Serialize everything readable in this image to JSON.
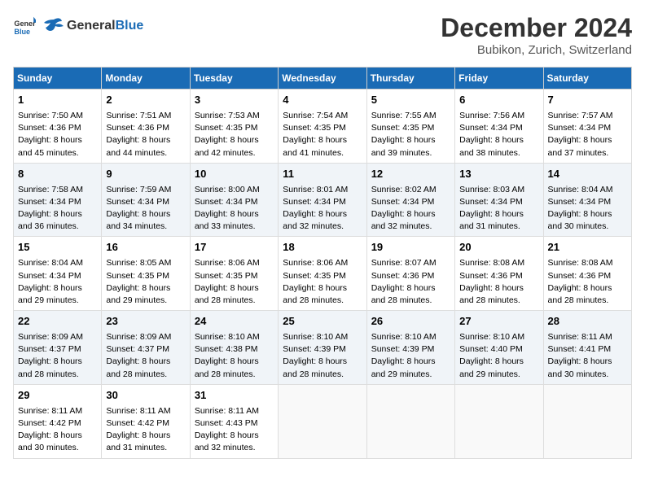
{
  "header": {
    "logo_general": "General",
    "logo_blue": "Blue",
    "month": "December 2024",
    "location": "Bubikon, Zurich, Switzerland"
  },
  "weekdays": [
    "Sunday",
    "Monday",
    "Tuesday",
    "Wednesday",
    "Thursday",
    "Friday",
    "Saturday"
  ],
  "weeks": [
    [
      {
        "day": "1",
        "sunrise": "Sunrise: 7:50 AM",
        "sunset": "Sunset: 4:36 PM",
        "daylight": "Daylight: 8 hours and 45 minutes."
      },
      {
        "day": "2",
        "sunrise": "Sunrise: 7:51 AM",
        "sunset": "Sunset: 4:36 PM",
        "daylight": "Daylight: 8 hours and 44 minutes."
      },
      {
        "day": "3",
        "sunrise": "Sunrise: 7:53 AM",
        "sunset": "Sunset: 4:35 PM",
        "daylight": "Daylight: 8 hours and 42 minutes."
      },
      {
        "day": "4",
        "sunrise": "Sunrise: 7:54 AM",
        "sunset": "Sunset: 4:35 PM",
        "daylight": "Daylight: 8 hours and 41 minutes."
      },
      {
        "day": "5",
        "sunrise": "Sunrise: 7:55 AM",
        "sunset": "Sunset: 4:35 PM",
        "daylight": "Daylight: 8 hours and 39 minutes."
      },
      {
        "day": "6",
        "sunrise": "Sunrise: 7:56 AM",
        "sunset": "Sunset: 4:34 PM",
        "daylight": "Daylight: 8 hours and 38 minutes."
      },
      {
        "day": "7",
        "sunrise": "Sunrise: 7:57 AM",
        "sunset": "Sunset: 4:34 PM",
        "daylight": "Daylight: 8 hours and 37 minutes."
      }
    ],
    [
      {
        "day": "8",
        "sunrise": "Sunrise: 7:58 AM",
        "sunset": "Sunset: 4:34 PM",
        "daylight": "Daylight: 8 hours and 36 minutes."
      },
      {
        "day": "9",
        "sunrise": "Sunrise: 7:59 AM",
        "sunset": "Sunset: 4:34 PM",
        "daylight": "Daylight: 8 hours and 34 minutes."
      },
      {
        "day": "10",
        "sunrise": "Sunrise: 8:00 AM",
        "sunset": "Sunset: 4:34 PM",
        "daylight": "Daylight: 8 hours and 33 minutes."
      },
      {
        "day": "11",
        "sunrise": "Sunrise: 8:01 AM",
        "sunset": "Sunset: 4:34 PM",
        "daylight": "Daylight: 8 hours and 32 minutes."
      },
      {
        "day": "12",
        "sunrise": "Sunrise: 8:02 AM",
        "sunset": "Sunset: 4:34 PM",
        "daylight": "Daylight: 8 hours and 32 minutes."
      },
      {
        "day": "13",
        "sunrise": "Sunrise: 8:03 AM",
        "sunset": "Sunset: 4:34 PM",
        "daylight": "Daylight: 8 hours and 31 minutes."
      },
      {
        "day": "14",
        "sunrise": "Sunrise: 8:04 AM",
        "sunset": "Sunset: 4:34 PM",
        "daylight": "Daylight: 8 hours and 30 minutes."
      }
    ],
    [
      {
        "day": "15",
        "sunrise": "Sunrise: 8:04 AM",
        "sunset": "Sunset: 4:34 PM",
        "daylight": "Daylight: 8 hours and 29 minutes."
      },
      {
        "day": "16",
        "sunrise": "Sunrise: 8:05 AM",
        "sunset": "Sunset: 4:35 PM",
        "daylight": "Daylight: 8 hours and 29 minutes."
      },
      {
        "day": "17",
        "sunrise": "Sunrise: 8:06 AM",
        "sunset": "Sunset: 4:35 PM",
        "daylight": "Daylight: 8 hours and 28 minutes."
      },
      {
        "day": "18",
        "sunrise": "Sunrise: 8:06 AM",
        "sunset": "Sunset: 4:35 PM",
        "daylight": "Daylight: 8 hours and 28 minutes."
      },
      {
        "day": "19",
        "sunrise": "Sunrise: 8:07 AM",
        "sunset": "Sunset: 4:36 PM",
        "daylight": "Daylight: 8 hours and 28 minutes."
      },
      {
        "day": "20",
        "sunrise": "Sunrise: 8:08 AM",
        "sunset": "Sunset: 4:36 PM",
        "daylight": "Daylight: 8 hours and 28 minutes."
      },
      {
        "day": "21",
        "sunrise": "Sunrise: 8:08 AM",
        "sunset": "Sunset: 4:36 PM",
        "daylight": "Daylight: 8 hours and 28 minutes."
      }
    ],
    [
      {
        "day": "22",
        "sunrise": "Sunrise: 8:09 AM",
        "sunset": "Sunset: 4:37 PM",
        "daylight": "Daylight: 8 hours and 28 minutes."
      },
      {
        "day": "23",
        "sunrise": "Sunrise: 8:09 AM",
        "sunset": "Sunset: 4:37 PM",
        "daylight": "Daylight: 8 hours and 28 minutes."
      },
      {
        "day": "24",
        "sunrise": "Sunrise: 8:10 AM",
        "sunset": "Sunset: 4:38 PM",
        "daylight": "Daylight: 8 hours and 28 minutes."
      },
      {
        "day": "25",
        "sunrise": "Sunrise: 8:10 AM",
        "sunset": "Sunset: 4:39 PM",
        "daylight": "Daylight: 8 hours and 28 minutes."
      },
      {
        "day": "26",
        "sunrise": "Sunrise: 8:10 AM",
        "sunset": "Sunset: 4:39 PM",
        "daylight": "Daylight: 8 hours and 29 minutes."
      },
      {
        "day": "27",
        "sunrise": "Sunrise: 8:10 AM",
        "sunset": "Sunset: 4:40 PM",
        "daylight": "Daylight: 8 hours and 29 minutes."
      },
      {
        "day": "28",
        "sunrise": "Sunrise: 8:11 AM",
        "sunset": "Sunset: 4:41 PM",
        "daylight": "Daylight: 8 hours and 30 minutes."
      }
    ],
    [
      {
        "day": "29",
        "sunrise": "Sunrise: 8:11 AM",
        "sunset": "Sunset: 4:42 PM",
        "daylight": "Daylight: 8 hours and 30 minutes."
      },
      {
        "day": "30",
        "sunrise": "Sunrise: 8:11 AM",
        "sunset": "Sunset: 4:42 PM",
        "daylight": "Daylight: 8 hours and 31 minutes."
      },
      {
        "day": "31",
        "sunrise": "Sunrise: 8:11 AM",
        "sunset": "Sunset: 4:43 PM",
        "daylight": "Daylight: 8 hours and 32 minutes."
      },
      null,
      null,
      null,
      null
    ]
  ]
}
